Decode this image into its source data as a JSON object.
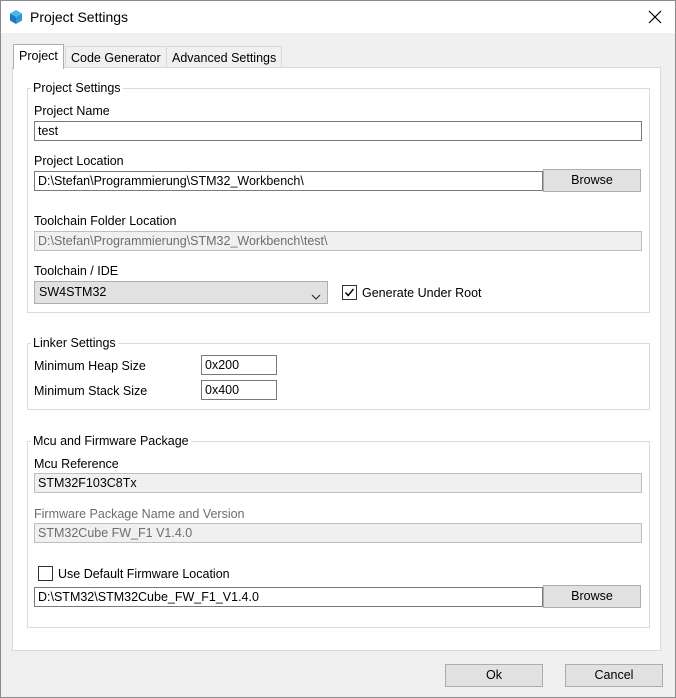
{
  "window": {
    "title": "Project Settings",
    "icon": "cube-icon"
  },
  "tabs": [
    {
      "label": "Project",
      "active": true
    },
    {
      "label": "Code Generator",
      "active": false
    },
    {
      "label": "Advanced Settings",
      "active": false
    }
  ],
  "project_settings": {
    "group_title": "Project Settings",
    "name_label": "Project Name",
    "name_value": "test",
    "location_label": "Project Location",
    "location_value": "D:\\Stefan\\Programmierung\\STM32_Workbench\\",
    "browse_label": "Browse",
    "toolchain_folder_label": "Toolchain Folder Location",
    "toolchain_folder_value": "D:\\Stefan\\Programmierung\\STM32_Workbench\\test\\",
    "toolchain_label": "Toolchain / IDE",
    "toolchain_value": "SW4STM32",
    "generate_under_root_label": "Generate Under Root",
    "generate_under_root_checked": true
  },
  "linker_settings": {
    "group_title": "Linker Settings",
    "heap_label": "Minimum Heap Size",
    "heap_value": "0x200",
    "stack_label": "Minimum Stack Size",
    "stack_value": "0x400"
  },
  "mcu_firmware": {
    "group_title": "Mcu and Firmware Package",
    "mcu_ref_label": "Mcu Reference",
    "mcu_ref_value": "STM32F103C8Tx",
    "fw_name_label": "Firmware Package Name and Version",
    "fw_name_value": "STM32Cube FW_F1 V1.4.0",
    "use_default_label": "Use Default Firmware Location",
    "use_default_checked": false,
    "fw_location_value": "D:\\STM32\\STM32Cube_FW_F1_V1.4.0",
    "browse_label": "Browse"
  },
  "footer": {
    "ok_label": "Ok",
    "cancel_label": "Cancel"
  }
}
